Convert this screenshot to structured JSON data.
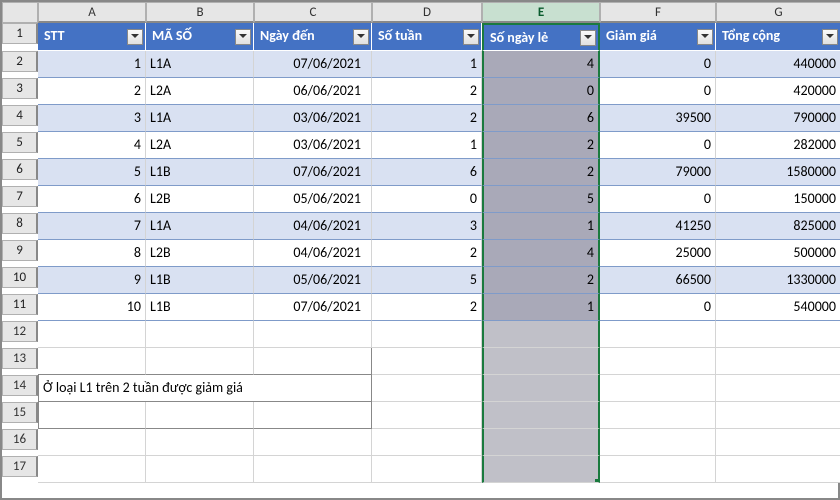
{
  "columns": [
    "A",
    "B",
    "C",
    "D",
    "E",
    "F",
    "G"
  ],
  "rows": [
    "1",
    "2",
    "3",
    "4",
    "5",
    "6",
    "7",
    "8",
    "9",
    "10",
    "11",
    "12",
    "13",
    "14",
    "15",
    "16",
    "17"
  ],
  "headers": {
    "stt": "STT",
    "maso": "MÃ SỐ",
    "ngayden": "Ngày đến",
    "sotuan": "Số tuần",
    "songayle": "Số ngày lẻ",
    "giamgia": "Giảm giá",
    "tongcong": "Tổng cộng"
  },
  "note": "Ở loại L1 trên 2 tuần được giảm giá",
  "data": [
    {
      "stt": "1",
      "maso": "L1A",
      "ngayden": "07/06/2021",
      "sotuan": "1",
      "songayle": "4",
      "giamgia": "0",
      "tongcong": "440000"
    },
    {
      "stt": "2",
      "maso": "L2A",
      "ngayden": "06/06/2021",
      "sotuan": "2",
      "songayle": "0",
      "giamgia": "0",
      "tongcong": "420000"
    },
    {
      "stt": "3",
      "maso": "L1A",
      "ngayden": "03/06/2021",
      "sotuan": "2",
      "songayle": "6",
      "giamgia": "39500",
      "tongcong": "790000"
    },
    {
      "stt": "4",
      "maso": "L2A",
      "ngayden": "03/06/2021",
      "sotuan": "1",
      "songayle": "2",
      "giamgia": "0",
      "tongcong": "282000"
    },
    {
      "stt": "5",
      "maso": "L1B",
      "ngayden": "07/06/2021",
      "sotuan": "6",
      "songayle": "2",
      "giamgia": "79000",
      "tongcong": "1580000"
    },
    {
      "stt": "6",
      "maso": "L2B",
      "ngayden": "05/06/2021",
      "sotuan": "0",
      "songayle": "5",
      "giamgia": "0",
      "tongcong": "150000"
    },
    {
      "stt": "7",
      "maso": "L1A",
      "ngayden": "04/06/2021",
      "sotuan": "3",
      "songayle": "1",
      "giamgia": "41250",
      "tongcong": "825000"
    },
    {
      "stt": "8",
      "maso": "L2B",
      "ngayden": "04/06/2021",
      "sotuan": "2",
      "songayle": "4",
      "giamgia": "25000",
      "tongcong": "500000"
    },
    {
      "stt": "9",
      "maso": "L1B",
      "ngayden": "05/06/2021",
      "sotuan": "5",
      "songayle": "2",
      "giamgia": "66500",
      "tongcong": "1330000"
    },
    {
      "stt": "10",
      "maso": "L1B",
      "ngayden": "07/06/2021",
      "sotuan": "2",
      "songayle": "1",
      "giamgia": "0",
      "tongcong": "540000"
    }
  ]
}
